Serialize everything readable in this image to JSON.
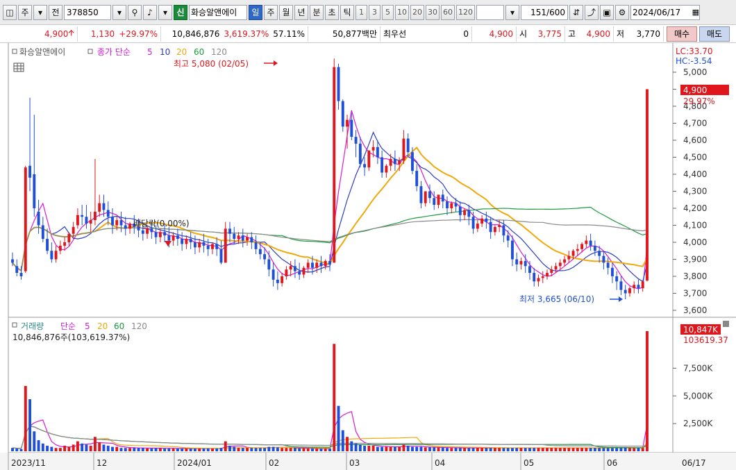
{
  "toolbar": {
    "period_toggle_label": "주",
    "prev_label": "전",
    "stock_code": "378850",
    "stock_name": "화승알앤에이",
    "shin_label": "신",
    "period_tabs": [
      "일",
      "주",
      "월",
      "년"
    ],
    "intra_tabs": [
      "분",
      "초",
      "틱"
    ],
    "intervals": [
      "1",
      "3",
      "5",
      "10",
      "20",
      "30",
      "60",
      "120"
    ],
    "count_value": "151",
    "count_total": "/600",
    "date": "2024/06/17"
  },
  "info": {
    "price": "4,900",
    "change": "1,130",
    "change_pct": "+29.97%",
    "volume": "10,846,876",
    "volume_pct": "3,619.37%",
    "turnover_pct": "57.11%",
    "trade_value": "50,877백만",
    "best_label": "최우선",
    "best_value": "0",
    "best_price": "4,900",
    "open_label": "시",
    "open": "3,775",
    "high_label": "고",
    "high": "4,900",
    "low_label": "저",
    "low": "3,770",
    "buy_label": "매수",
    "sell_label": "매도"
  },
  "price_panel": {
    "stock_label": "화승알앤에이",
    "ma_title": "종가 단순",
    "ma_periods": [
      "5",
      "10",
      "20",
      "60",
      "120"
    ],
    "lc_label": "LC:33.70",
    "hc_label": "HC:-3.54",
    "current_price_label": "4,900",
    "current_pct_label": "29.97%",
    "high_annotation": "최고 5,080 (02/05)",
    "low_annotation": "최저 3,665 (06/10)",
    "dividend_annotation": "배당락(0.00%)",
    "y_ticks": [
      "5,000",
      "4,900",
      "4,800",
      "4,700",
      "4,600",
      "4,500",
      "4,400",
      "4,300",
      "4,200",
      "4,100",
      "4,000",
      "3,900",
      "3,800",
      "3,700",
      "3,600"
    ]
  },
  "volume_panel": {
    "title": "거래량",
    "ma_title": "단순",
    "ma_periods": [
      "5",
      "20",
      "60",
      "120"
    ],
    "summary": "10,846,876주(103,619.37%)",
    "current_label": "10,847K",
    "current_pct_label": "103619.37",
    "y_ticks": [
      "7,500K",
      "5,000K",
      "2,500K"
    ]
  },
  "x_axis": {
    "labels": [
      "2023/11",
      "12",
      "2024/01",
      "02",
      "03",
      "04",
      "05",
      "06"
    ],
    "current_label": "06/17"
  },
  "colors": {
    "up": "#e0161d",
    "down": "#1f4fd6",
    "ma5": "#d81ad8",
    "ma10": "#2b3cc4",
    "ma20": "#f0a80a",
    "ma60": "#1a9a3a",
    "ma120": "#8a8a8a"
  },
  "chart_data": {
    "type": "candlestick",
    "price_range": [
      3600,
      5080
    ],
    "candles": [
      [
        3900,
        3940,
        3880,
        3860
      ],
      [
        3860,
        3900,
        3820,
        3800
      ],
      [
        3820,
        3860,
        3800,
        3780
      ],
      [
        3830,
        4450,
        4440,
        3820
      ],
      [
        4450,
        4850,
        4380,
        4300
      ],
      [
        4400,
        4750,
        4200,
        4150
      ],
      [
        4180,
        4250,
        4100,
        4050
      ],
      [
        4100,
        4150,
        4020,
        4000
      ],
      [
        4020,
        4080,
        3950,
        3930
      ],
      [
        3950,
        4000,
        3900,
        3880
      ],
      [
        3900,
        3980,
        3950,
        3880
      ],
      [
        3950,
        4010,
        3980,
        3930
      ],
      [
        3980,
        4030,
        4000,
        3950
      ],
      [
        4000,
        4060,
        4050,
        3980
      ],
      [
        4050,
        4120,
        4090,
        4020
      ],
      [
        4100,
        4200,
        4160,
        4080
      ],
      [
        4160,
        4220,
        4150,
        4100
      ],
      [
        4150,
        4220,
        4110,
        4080
      ],
      [
        4110,
        4180,
        4130,
        4060
      ],
      [
        4130,
        4490,
        4180,
        4100
      ],
      [
        4180,
        4280,
        4230,
        4150
      ],
      [
        4230,
        4280,
        4190,
        4150
      ],
      [
        4190,
        4240,
        4150,
        4100
      ],
      [
        4150,
        4200,
        4100,
        4050
      ],
      [
        4100,
        4150,
        4130,
        4070
      ],
      [
        4130,
        4180,
        4100,
        4060
      ],
      [
        4100,
        4150,
        4080,
        4040
      ],
      [
        4080,
        4120,
        4110,
        4050
      ],
      [
        4110,
        4160,
        4090,
        4050
      ],
      [
        4090,
        4140,
        4070,
        4030
      ],
      [
        4070,
        4120,
        4050,
        4010
      ],
      [
        4050,
        4100,
        4080,
        4020
      ],
      [
        4080,
        4120,
        4060,
        4020
      ],
      [
        4060,
        4100,
        4030,
        3990
      ],
      [
        4030,
        4080,
        4060,
        4000
      ],
      [
        4060,
        4110,
        4040,
        4000
      ],
      [
        4040,
        4090,
        4010,
        3970
      ],
      [
        4010,
        4060,
        4040,
        3980
      ],
      [
        4040,
        4080,
        4020,
        3980
      ],
      [
        4020,
        4060,
        3990,
        3950
      ],
      [
        3990,
        4040,
        4020,
        3960
      ],
      [
        4020,
        4060,
        4000,
        3960
      ],
      [
        4000,
        4040,
        3970,
        3930
      ],
      [
        3970,
        4020,
        4000,
        3940
      ],
      [
        4000,
        4050,
        3980,
        3940
      ],
      [
        3980,
        4020,
        3960,
        3920
      ],
      [
        3960,
        4000,
        3990,
        3930
      ],
      [
        3990,
        4030,
        3960,
        3920
      ],
      [
        3960,
        4010,
        3880,
        3870
      ],
      [
        3880,
        4120,
        4080,
        3880
      ],
      [
        4080,
        4120,
        4050,
        4000
      ],
      [
        4050,
        4090,
        4020,
        3990
      ],
      [
        4020,
        4060,
        4040,
        3990
      ],
      [
        4040,
        4080,
        4010,
        3970
      ],
      [
        4010,
        4050,
        4030,
        3980
      ],
      [
        4030,
        4060,
        4000,
        3960
      ],
      [
        4000,
        4040,
        3960,
        3930
      ],
      [
        3960,
        4000,
        3930,
        3900
      ],
      [
        3930,
        3970,
        3900,
        3870
      ],
      [
        3900,
        3950,
        3840,
        3800
      ],
      [
        3840,
        3880,
        3780,
        3740
      ],
      [
        3780,
        3830,
        3760,
        3720
      ],
      [
        3760,
        3820,
        3800,
        3740
      ],
      [
        3800,
        3860,
        3840,
        3780
      ],
      [
        3840,
        3890,
        3860,
        3800
      ],
      [
        3860,
        3900,
        3830,
        3790
      ],
      [
        3830,
        3880,
        3810,
        3780
      ],
      [
        3810,
        3860,
        3850,
        3790
      ],
      [
        3850,
        3900,
        3880,
        3820
      ],
      [
        3880,
        3920,
        3850,
        3810
      ],
      [
        3850,
        3900,
        3880,
        3820
      ],
      [
        3880,
        3920,
        3860,
        3820
      ],
      [
        3860,
        3900,
        3890,
        3840
      ],
      [
        3890,
        3930,
        3870,
        3830
      ],
      [
        3880,
        5080,
        5030,
        3880
      ],
      [
        5030,
        5050,
        4830,
        4780
      ],
      [
        4830,
        4840,
        4680,
        4650
      ],
      [
        4680,
        4750,
        4720,
        4550
      ],
      [
        4720,
        4760,
        4620,
        4600
      ],
      [
        4620,
        4660,
        4580,
        4500
      ],
      [
        4580,
        4620,
        4460,
        4440
      ],
      [
        4460,
        4500,
        4440,
        4390
      ],
      [
        4440,
        4480,
        4540,
        4420
      ],
      [
        4540,
        4600,
        4560,
        4500
      ],
      [
        4560,
        4600,
        4500,
        4460
      ],
      [
        4500,
        4540,
        4410,
        4380
      ],
      [
        4410,
        4460,
        4450,
        4380
      ],
      [
        4450,
        4520,
        4490,
        4420
      ],
      [
        4490,
        4540,
        4460,
        4420
      ],
      [
        4460,
        4500,
        4480,
        4420
      ],
      [
        4480,
        4660,
        4610,
        4460
      ],
      [
        4610,
        4640,
        4530,
        4500
      ],
      [
        4530,
        4560,
        4420,
        4400
      ],
      [
        4420,
        4460,
        4330,
        4300
      ],
      [
        4330,
        4360,
        4230,
        4200
      ],
      [
        4230,
        4260,
        4300,
        4210
      ],
      [
        4300,
        4340,
        4260,
        4230
      ],
      [
        4260,
        4300,
        4220,
        4190
      ],
      [
        4220,
        4260,
        4280,
        4200
      ],
      [
        4280,
        4310,
        4240,
        4200
      ],
      [
        4240,
        4270,
        4200,
        4160
      ],
      [
        4200,
        4240,
        4230,
        4170
      ],
      [
        4230,
        4260,
        4210,
        4180
      ],
      [
        4210,
        4240,
        4160,
        4120
      ],
      [
        4160,
        4200,
        4190,
        4130
      ],
      [
        4190,
        4220,
        4150,
        4100
      ],
      [
        4150,
        4180,
        4080,
        4050
      ],
      [
        4080,
        4130,
        4110,
        4060
      ],
      [
        4110,
        4160,
        4140,
        4090
      ],
      [
        4140,
        4180,
        4120,
        4080
      ],
      [
        4120,
        4150,
        4060,
        4020
      ],
      [
        4060,
        4100,
        4090,
        4040
      ],
      [
        4090,
        4130,
        4100,
        4060
      ],
      [
        4100,
        4130,
        4040,
        4000
      ],
      [
        4040,
        4070,
        4010,
        3970
      ],
      [
        4010,
        4040,
        3900,
        3860
      ],
      [
        3900,
        3940,
        3870,
        3830
      ],
      [
        3870,
        3910,
        3890,
        3840
      ],
      [
        3890,
        3930,
        3860,
        3820
      ],
      [
        3860,
        3890,
        3820,
        3780
      ],
      [
        3820,
        3850,
        3770,
        3740
      ],
      [
        3770,
        3810,
        3790,
        3740
      ],
      [
        3790,
        3830,
        3800,
        3760
      ],
      [
        3800,
        3840,
        3820,
        3780
      ],
      [
        3820,
        3860,
        3840,
        3800
      ],
      [
        3840,
        3880,
        3860,
        3820
      ],
      [
        3860,
        3900,
        3880,
        3840
      ],
      [
        3880,
        3920,
        3900,
        3860
      ],
      [
        3900,
        3950,
        3920,
        3880
      ],
      [
        3920,
        3960,
        3950,
        3900
      ],
      [
        3950,
        3990,
        3960,
        3920
      ],
      [
        3960,
        4000,
        3990,
        3940
      ],
      [
        3990,
        4040,
        4010,
        3970
      ],
      [
        4010,
        4050,
        3980,
        3950
      ],
      [
        3980,
        4010,
        3950,
        3920
      ],
      [
        3950,
        3980,
        3920,
        3880
      ],
      [
        3920,
        3950,
        3880,
        3840
      ],
      [
        3880,
        3910,
        3850,
        3810
      ],
      [
        3850,
        3880,
        3800,
        3760
      ],
      [
        3800,
        3830,
        3770,
        3720
      ],
      [
        3770,
        3800,
        3720,
        3690
      ],
      [
        3720,
        3750,
        3700,
        3665
      ],
      [
        3700,
        3740,
        3730,
        3680
      ],
      [
        3730,
        3770,
        3750,
        3700
      ],
      [
        3750,
        3780,
        3730,
        3700
      ],
      [
        3730,
        3760,
        3770,
        3710
      ],
      [
        3775,
        4900,
        4900,
        3770
      ]
    ],
    "volume_range_k": [
      0,
      10847
    ],
    "volume_k": [
      300,
      250,
      200,
      5900,
      4700,
      1800,
      1000,
      700,
      500,
      400,
      300,
      300,
      500,
      400,
      600,
      900,
      700,
      600,
      500,
      1300,
      800,
      600,
      500,
      400,
      400,
      300,
      300,
      300,
      300,
      300,
      300,
      250,
      250,
      300,
      300,
      250,
      250,
      250,
      250,
      250,
      250,
      250,
      250,
      250,
      250,
      250,
      250,
      250,
      300,
      900,
      500,
      400,
      300,
      300,
      300,
      300,
      300,
      300,
      300,
      400,
      400,
      350,
      300,
      300,
      300,
      300,
      250,
      250,
      250,
      250,
      250,
      250,
      250,
      250,
      9700,
      4100,
      1900,
      1300,
      900,
      700,
      600,
      500,
      500,
      500,
      400,
      400,
      400,
      400,
      400,
      400,
      600,
      500,
      400,
      400,
      400,
      350,
      350,
      350,
      350,
      350,
      300,
      300,
      300,
      300,
      300,
      300,
      300,
      300,
      300,
      300,
      300,
      300,
      300,
      300,
      300,
      300,
      300,
      300,
      300,
      300,
      300,
      300,
      300,
      300,
      300,
      300,
      300,
      300,
      300,
      300,
      300,
      300,
      300,
      300,
      300,
      300,
      300,
      300,
      300,
      300,
      300,
      350,
      300,
      300,
      300,
      300,
      10847
    ]
  }
}
